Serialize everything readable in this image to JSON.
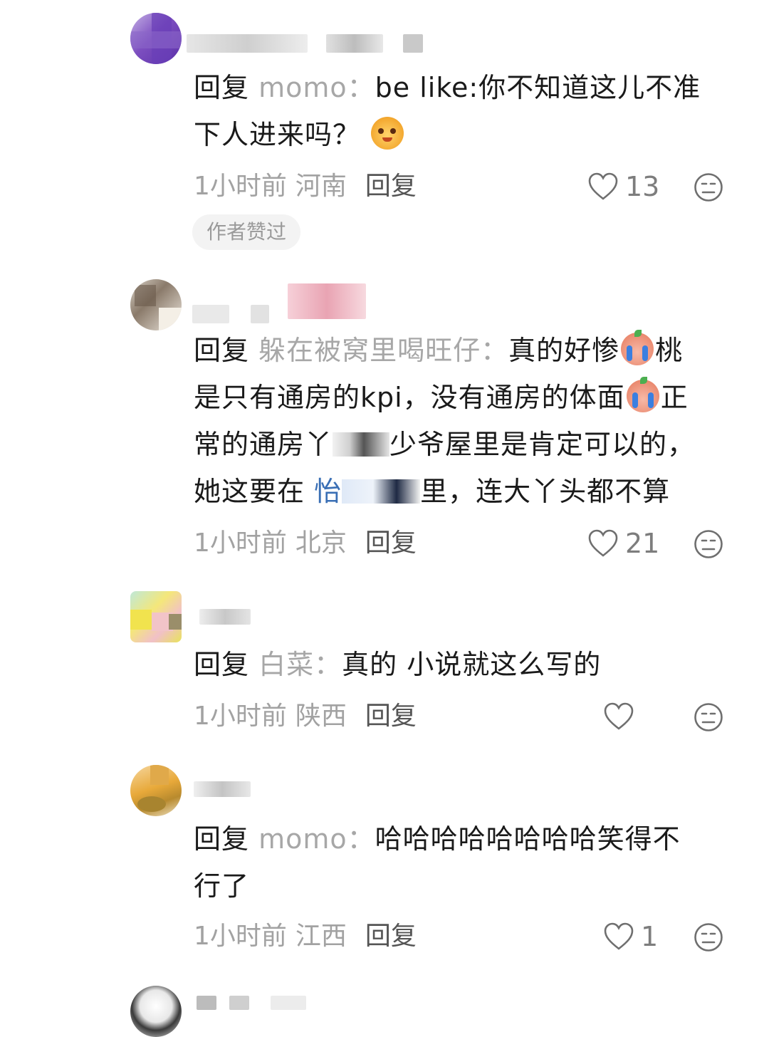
{
  "comments": [
    {
      "reply_prefix": "回复",
      "target": "momo：",
      "text_lines": [
        "be like:你不知道这儿不准",
        "下人进来吗？"
      ],
      "time": "1小时前",
      "location": "河南",
      "reply_label": "回复",
      "likes": "13",
      "badge": "作者赞过"
    },
    {
      "reply_prefix": "回复",
      "target": "躲在被窝里喝旺仔：",
      "line1": "真的好惨",
      "line1_tail": "桃",
      "line2": "是只有通房的kpi，没有通房的体面",
      "line2_tail": "正",
      "line3a": "常的通房丫",
      "line3b": "少爷屋里是肯定可以的，",
      "line4a": "她这要在",
      "line4b": "怡",
      "line4c": "里，连大丫头都不算",
      "time": "1小时前",
      "location": "北京",
      "reply_label": "回复",
      "likes": "21"
    },
    {
      "reply_prefix": "回复",
      "target": "白菜：",
      "text": "真的 小说就这么写的",
      "time": "1小时前",
      "location": "陕西",
      "reply_label": "回复",
      "likes": ""
    },
    {
      "reply_prefix": "回复",
      "target": "momo：",
      "text_lines": [
        "哈哈哈哈哈哈哈哈笑得不",
        "行了"
      ],
      "time": "1小时前",
      "location": "江西",
      "reply_label": "回复",
      "likes": "1"
    }
  ],
  "colors": {
    "text": "#1a1a1a",
    "muted": "#a2a2a2",
    "target": "#a7a7a7",
    "badge_bg": "#f3f3f3"
  },
  "icons": [
    "heart-outline-icon",
    "dislike-face-icon"
  ]
}
